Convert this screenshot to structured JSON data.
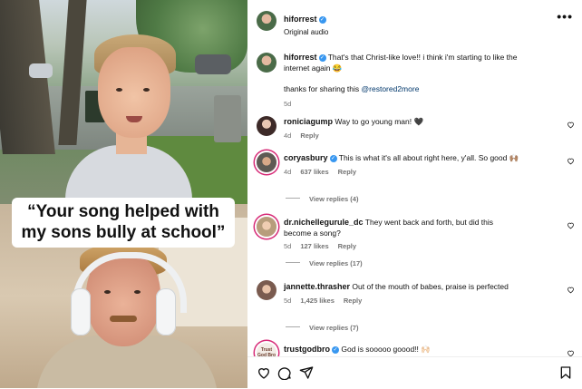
{
  "video": {
    "caption": "“Your song helped with my sons bully at school”"
  },
  "post": {
    "username": "hiforrest",
    "audio": "Original audio",
    "more_icon": "more-horizontal-icon"
  },
  "original_comment": {
    "username": "hiforrest",
    "text": "That's that Christ-like love!! i think i'm starting to like the internet again 😂",
    "text2_prefix": "thanks for sharing this ",
    "mention": "@restored2more",
    "time": "5d"
  },
  "comments": [
    {
      "username": "roniciagump",
      "verified": false,
      "text": "Way to go young man! 🖤",
      "time": "4d",
      "likes": "",
      "reply": "Reply",
      "view_replies": ""
    },
    {
      "username": "coryasbury",
      "verified": true,
      "text": "This is what it's all about right here, y'all. So good 🙌🏽",
      "time": "4d",
      "likes": "637 likes",
      "reply": "Reply",
      "view_replies": "View replies (4)"
    },
    {
      "username": "dr.nichellegurule_dc",
      "verified": false,
      "text": "They went back and forth, but did this become a song?",
      "time": "5d",
      "likes": "127 likes",
      "reply": "Reply",
      "view_replies": "View replies (17)"
    },
    {
      "username": "jannette.thrasher",
      "verified": false,
      "text": "Out of the mouth of babes, praise is perfected",
      "time": "5d",
      "likes": "1,425 likes",
      "reply": "Reply",
      "view_replies": "View replies (7)"
    },
    {
      "username": "trustgodbro",
      "verified": true,
      "text": "God is sooooo goood!! 🙌🏻",
      "time": "",
      "likes": "",
      "reply": "",
      "view_replies": ""
    }
  ],
  "trust_avatar_text": "Trust God Bro",
  "toolbar": {
    "like": "heart-icon",
    "comment": "comment-icon",
    "share": "send-icon",
    "save": "bookmark-icon"
  },
  "colors": {
    "verified": "#3897f0",
    "mention": "#00376b",
    "meta": "#737373"
  }
}
